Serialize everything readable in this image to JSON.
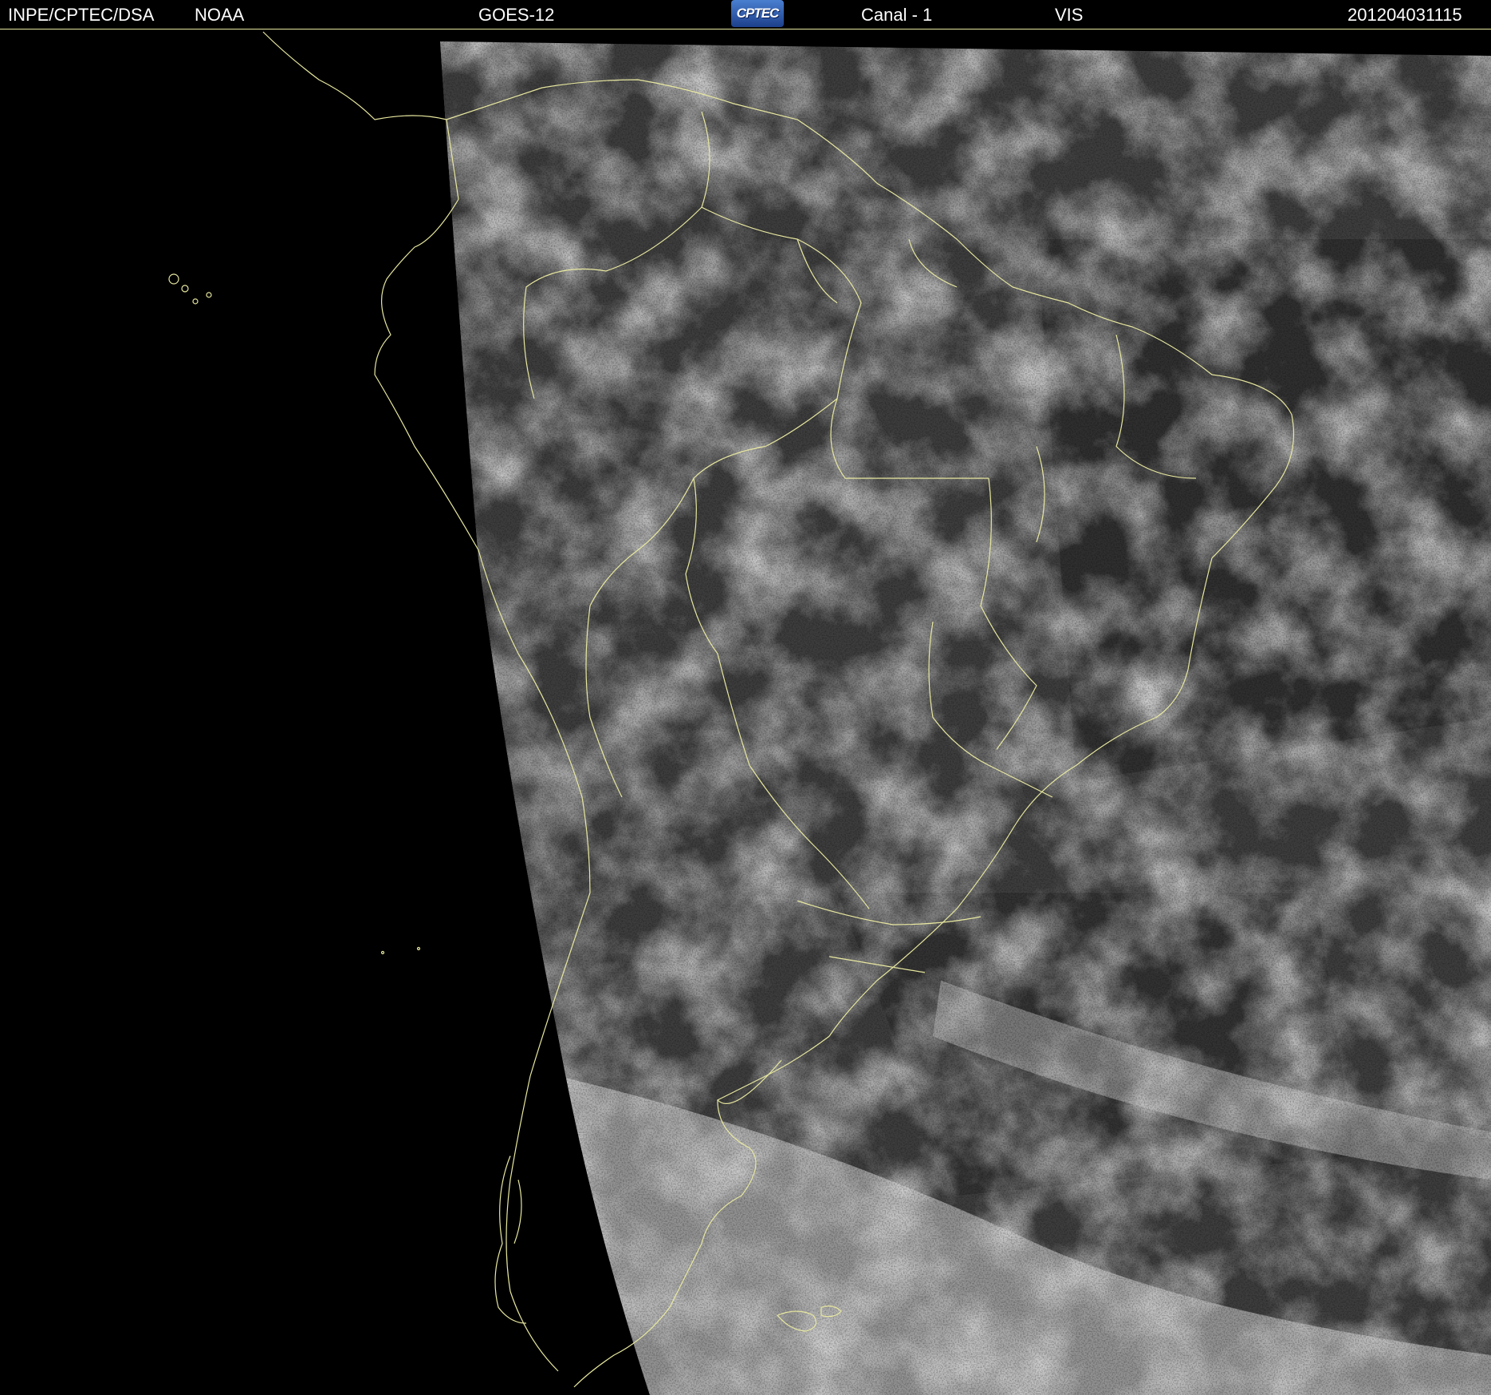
{
  "header": {
    "agency": "INPE/CPTEC/DSA",
    "provider": "NOAA",
    "satellite": "GOES-12",
    "logo_text": "CPTEC",
    "channel": "Canal - 1",
    "band": "VIS",
    "timestamp": "201204031115"
  },
  "colors": {
    "background": "#000000",
    "header_text": "#ffffff",
    "map_borders": "#e8e8a0",
    "logo_blue": "#2f5fb5"
  },
  "icons": {
    "logo": "cptec-logo"
  }
}
